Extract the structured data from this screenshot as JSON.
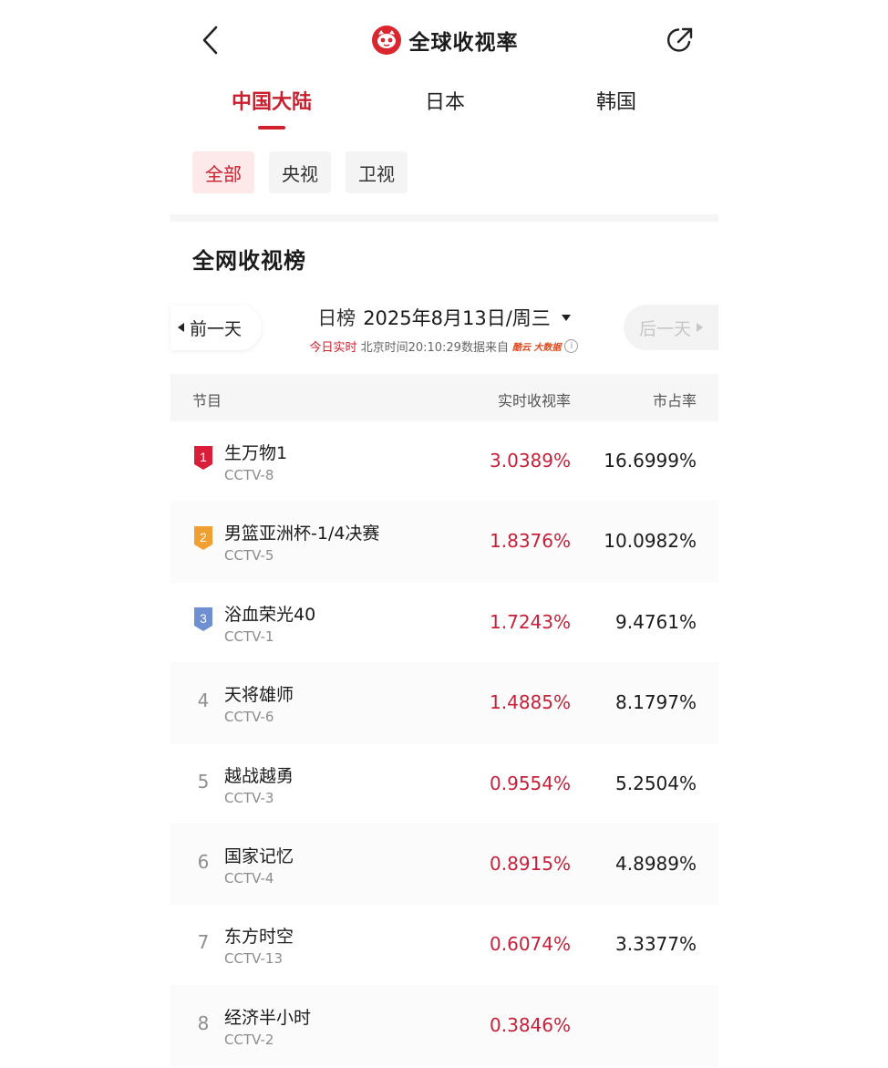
{
  "header": {
    "title": "全球收视率"
  },
  "region_tabs": [
    {
      "label": "中国大陆",
      "active": true
    },
    {
      "label": "日本",
      "active": false
    },
    {
      "label": "韩国",
      "active": false
    }
  ],
  "channel_filters": [
    {
      "label": "全部",
      "active": true
    },
    {
      "label": "央视",
      "active": false
    },
    {
      "label": "卫视",
      "active": false
    }
  ],
  "section_title": "全网收视榜",
  "day_nav": {
    "prev_label": "前一天",
    "next_label": "后一天",
    "kind": "日榜",
    "date": "2025年8月13日/周三",
    "live_label": "今日实时",
    "time_text": "北京时间20:10:29数据来自",
    "source_logo_text": "酷云 大数据"
  },
  "table": {
    "columns": [
      "节目",
      "实时收视率",
      "市占率"
    ],
    "rows": [
      {
        "rank": "1",
        "name": "生万物1",
        "channel": "CCTV-8",
        "rate": "3.0389%",
        "share": "16.6999%"
      },
      {
        "rank": "2",
        "name": "男篮亚洲杯-1/4决赛",
        "channel": "CCTV-5",
        "rate": "1.8376%",
        "share": "10.0982%"
      },
      {
        "rank": "3",
        "name": "浴血荣光40",
        "channel": "CCTV-1",
        "rate": "1.7243%",
        "share": "9.4761%"
      },
      {
        "rank": "4",
        "name": "天将雄师",
        "channel": "CCTV-6",
        "rate": "1.4885%",
        "share": "8.1797%"
      },
      {
        "rank": "5",
        "name": "越战越勇",
        "channel": "CCTV-3",
        "rate": "0.9554%",
        "share": "5.2504%"
      },
      {
        "rank": "6",
        "name": "国家记忆",
        "channel": "CCTV-4",
        "rate": "0.8915%",
        "share": "4.8989%"
      },
      {
        "rank": "7",
        "name": "东方时空",
        "channel": "CCTV-13",
        "rate": "0.6074%",
        "share": "3.3377%"
      },
      {
        "rank": "8",
        "name": "经济半小时",
        "channel": "CCTV-2",
        "rate": "0.3846%",
        "share": ""
      }
    ]
  },
  "colors": {
    "accent": "#c8202f",
    "rank1": "#d81e3a",
    "rank2": "#f0a032",
    "rank3": "#6e8fd0"
  }
}
